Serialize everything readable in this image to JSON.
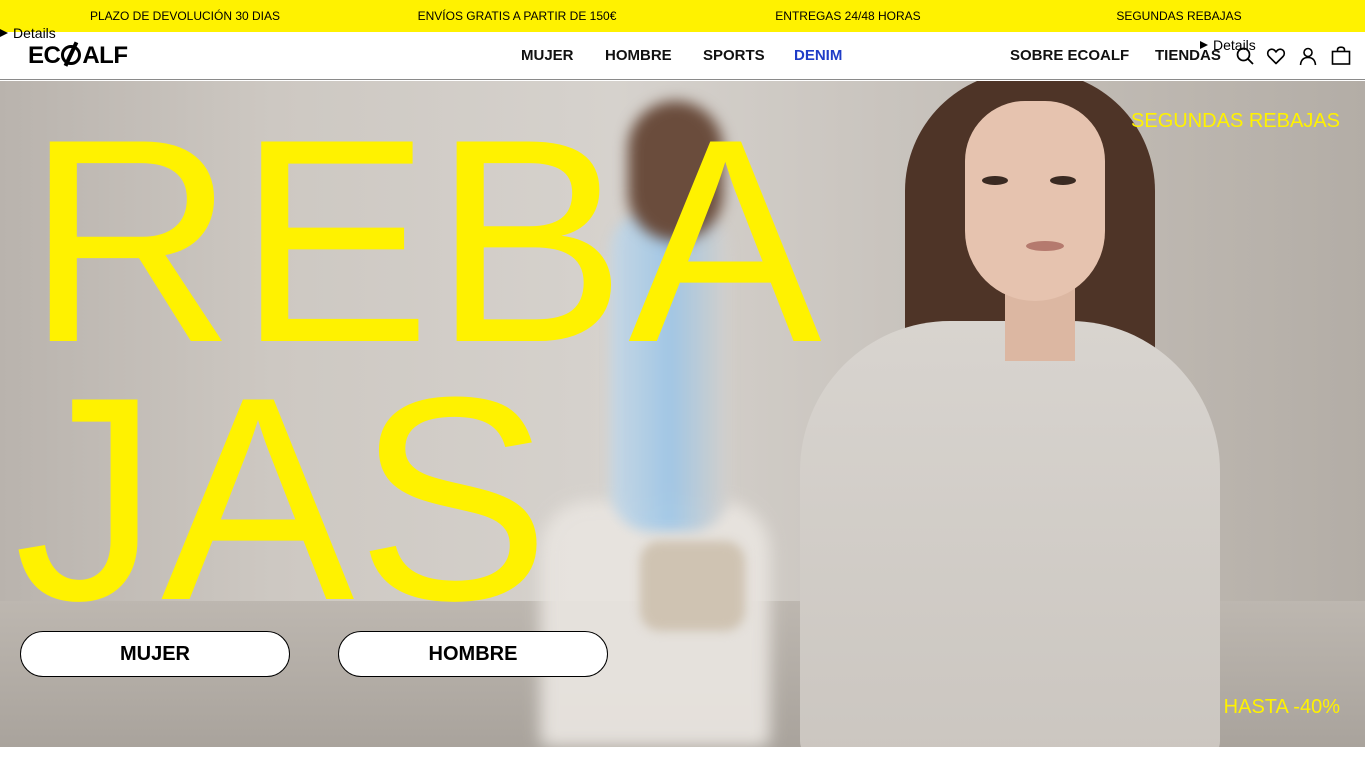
{
  "promo_bar": {
    "items": [
      "PLAZO DE DEVOLUCIÓN 30 DIAS",
      "ENVÍOS GRATIS A PARTIR DE 150€",
      "ENTREGAS 24/48 HORAS",
      "SEGUNDAS REBAJAS"
    ],
    "background": "#fff200"
  },
  "details_left": "Details",
  "details_right": "Details",
  "header": {
    "logo_prefix": "EC",
    "logo_suffix": "ALF",
    "nav": [
      "MUJER",
      "HOMBRE",
      "SPORTS",
      "DENIM"
    ],
    "nav_active_color": "#1f3cc7",
    "right_links": [
      "SOBRE ECOALF",
      "TIENDAS"
    ],
    "icons": [
      "search-icon",
      "heart-icon",
      "user-icon",
      "bag-icon"
    ]
  },
  "hero": {
    "title_line1": "REBA",
    "title_line2": "JAS",
    "tag_top": "SEGUNDAS REBAJAS",
    "tag_bottom": "HASTA -40%",
    "accent_color": "#fff200",
    "buttons": [
      "MUJER",
      "HOMBRE"
    ]
  }
}
